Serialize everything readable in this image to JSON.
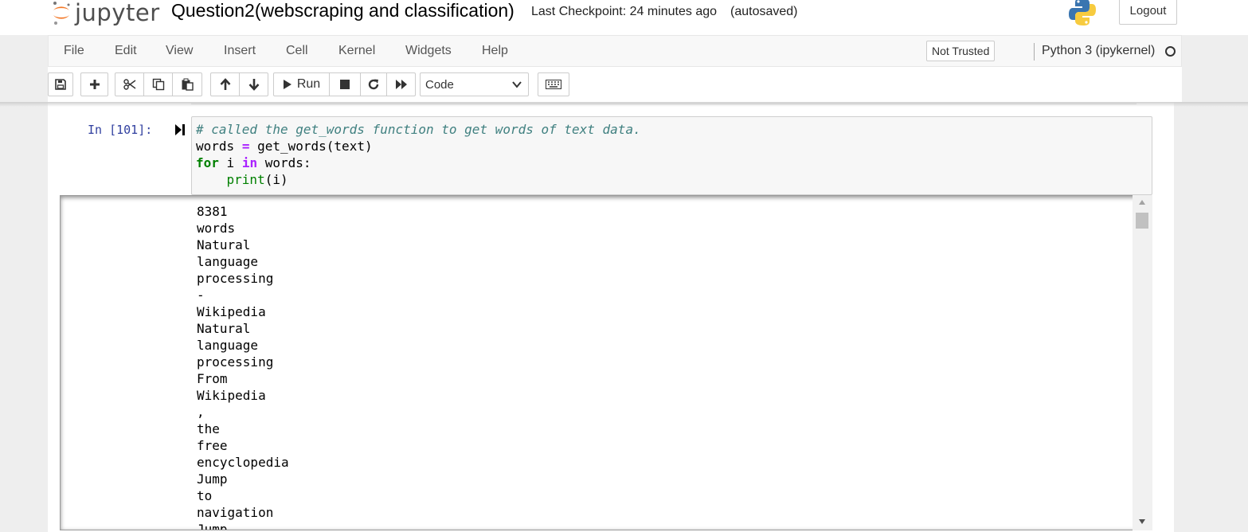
{
  "header": {
    "logo_text": "jupyter",
    "notebook_title": "Question2(webscraping and classification)",
    "checkpoint": "Last Checkpoint: 24 minutes ago",
    "autosave": "(autosaved)",
    "logout_label": "Logout",
    "python_logo": "python-logo-icon"
  },
  "menu": {
    "items": [
      "File",
      "Edit",
      "View",
      "Insert",
      "Cell",
      "Kernel",
      "Widgets",
      "Help"
    ],
    "trust_status": "Not Trusted",
    "kernel_name": "Python 3 (ipykernel)",
    "kernel_status": "idle"
  },
  "toolbar": {
    "icons": [
      "save-icon",
      "plus-icon",
      "cut-icon",
      "copy-icon",
      "paste-icon",
      "arrow-up-icon",
      "arrow-down-icon",
      "play-icon",
      "stop-icon",
      "restart-icon",
      "fast-forward-icon",
      "keyboard-icon"
    ],
    "run_label": "Run",
    "cell_type": "Code"
  },
  "cell": {
    "prompt": "In [101]:",
    "code": {
      "comment": "# called the get_words function to get words of text data.",
      "line2_var": "words",
      "line2_eq": "=",
      "line2_call": "get_words(text)",
      "line3_for": "for",
      "line3_i": "i",
      "line3_in": "in",
      "line3_rest": "words:",
      "line4_indent": "    ",
      "line4_print": "print",
      "line4_args": "(i)"
    },
    "output_lines": [
      "8381",
      "words",
      "Natural",
      "language",
      "processing",
      "-",
      "Wikipedia",
      "Natural",
      "language",
      "processing",
      "From",
      "Wikipedia",
      ",",
      "the",
      "free",
      "encyclopedia",
      "Jump",
      "to",
      "navigation",
      "Jump"
    ]
  },
  "colors": {
    "prompt": "#303f9f",
    "comment": "#408080",
    "keyword": "#008000",
    "operator": "#aa22ff",
    "jupyter_orange": "#f37726"
  }
}
